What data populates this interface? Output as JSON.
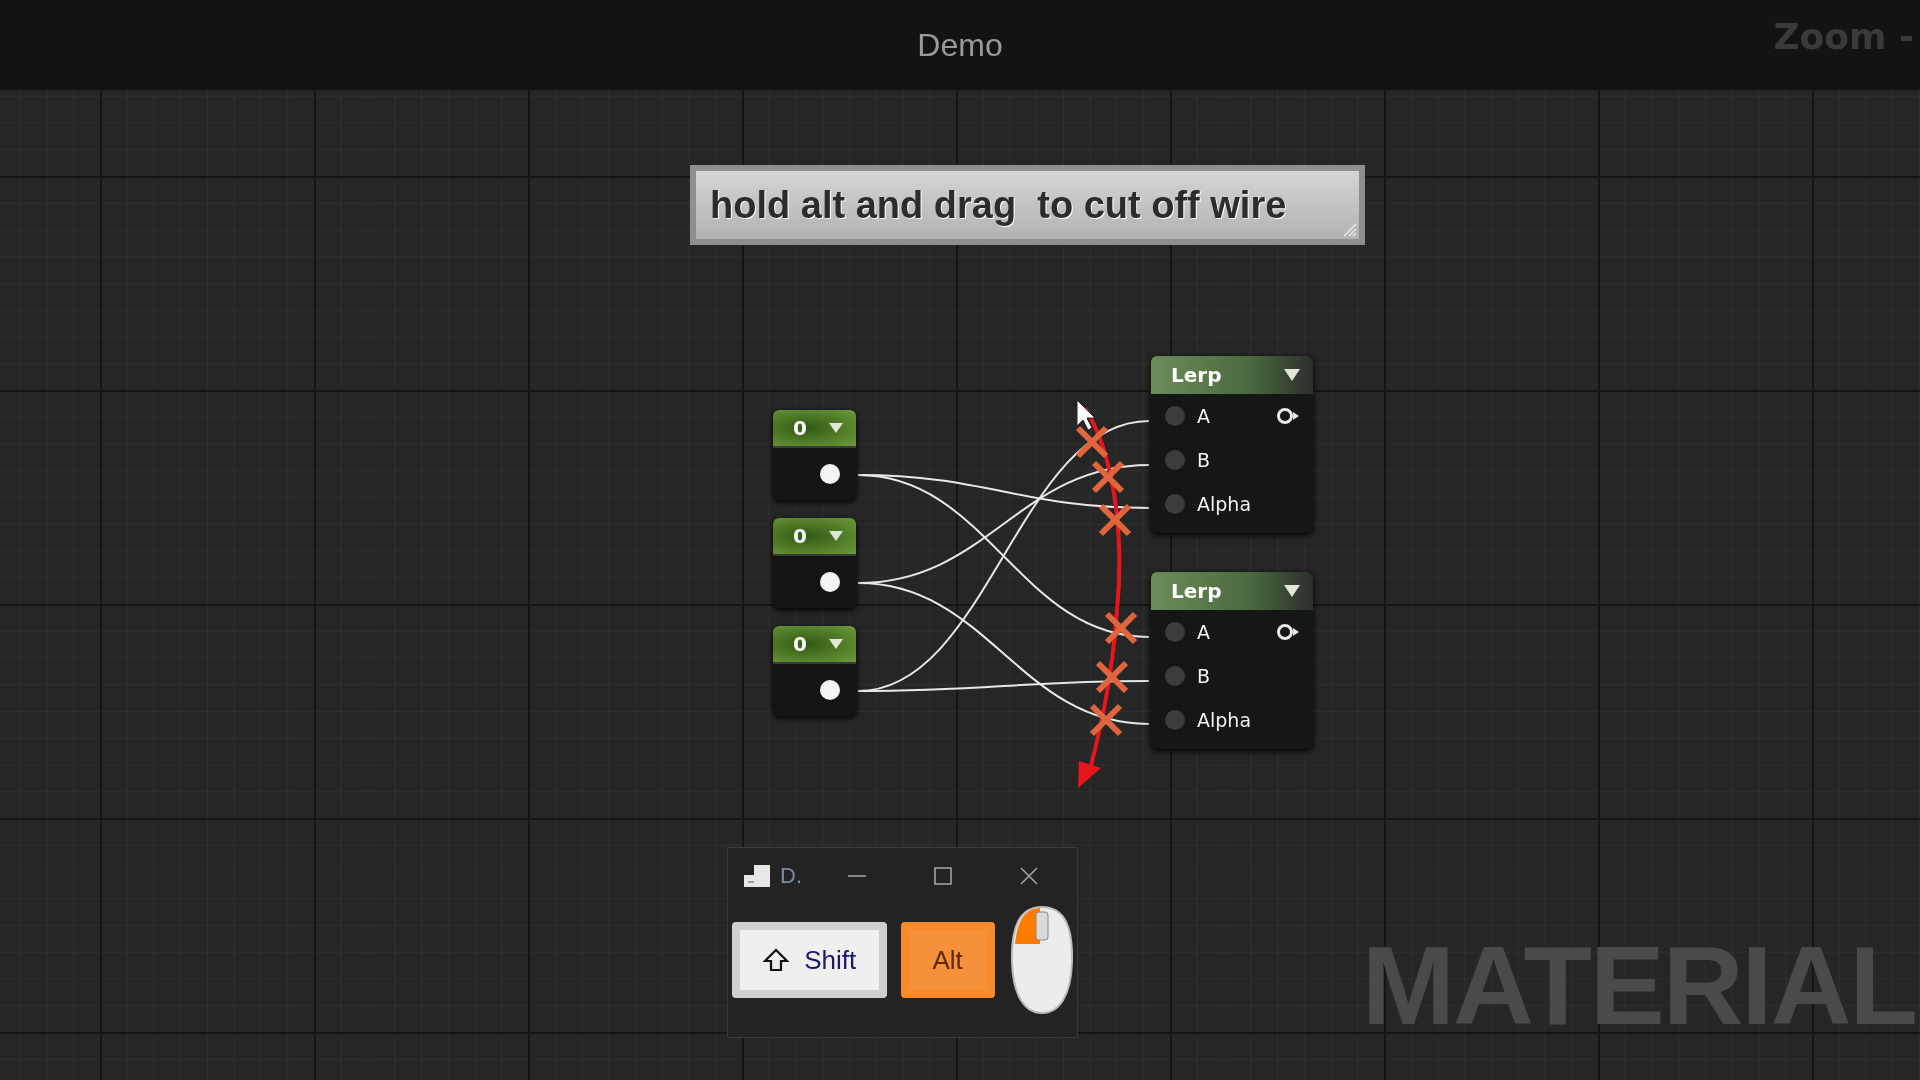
{
  "window": {
    "title": "Demo",
    "zoom_label": "Zoom -"
  },
  "comment": {
    "text": "hold alt and drag  to cut off wire"
  },
  "constant_nodes": [
    {
      "value": "0"
    },
    {
      "value": "0"
    },
    {
      "value": "0"
    }
  ],
  "lerp_nodes": [
    {
      "title": "Lerp",
      "inputs": [
        "A",
        "B",
        "Alpha"
      ]
    },
    {
      "title": "Lerp",
      "inputs": [
        "A",
        "B",
        "Alpha"
      ]
    }
  ],
  "graph_watermark": "MATERIAL",
  "key_overlay": {
    "title": "D.",
    "keys": [
      {
        "label": "Shift",
        "kind": "shift",
        "pressed": false
      },
      {
        "label": "Alt",
        "kind": "plain",
        "pressed": true
      }
    ],
    "mouse": {
      "left_pressed": true
    }
  }
}
